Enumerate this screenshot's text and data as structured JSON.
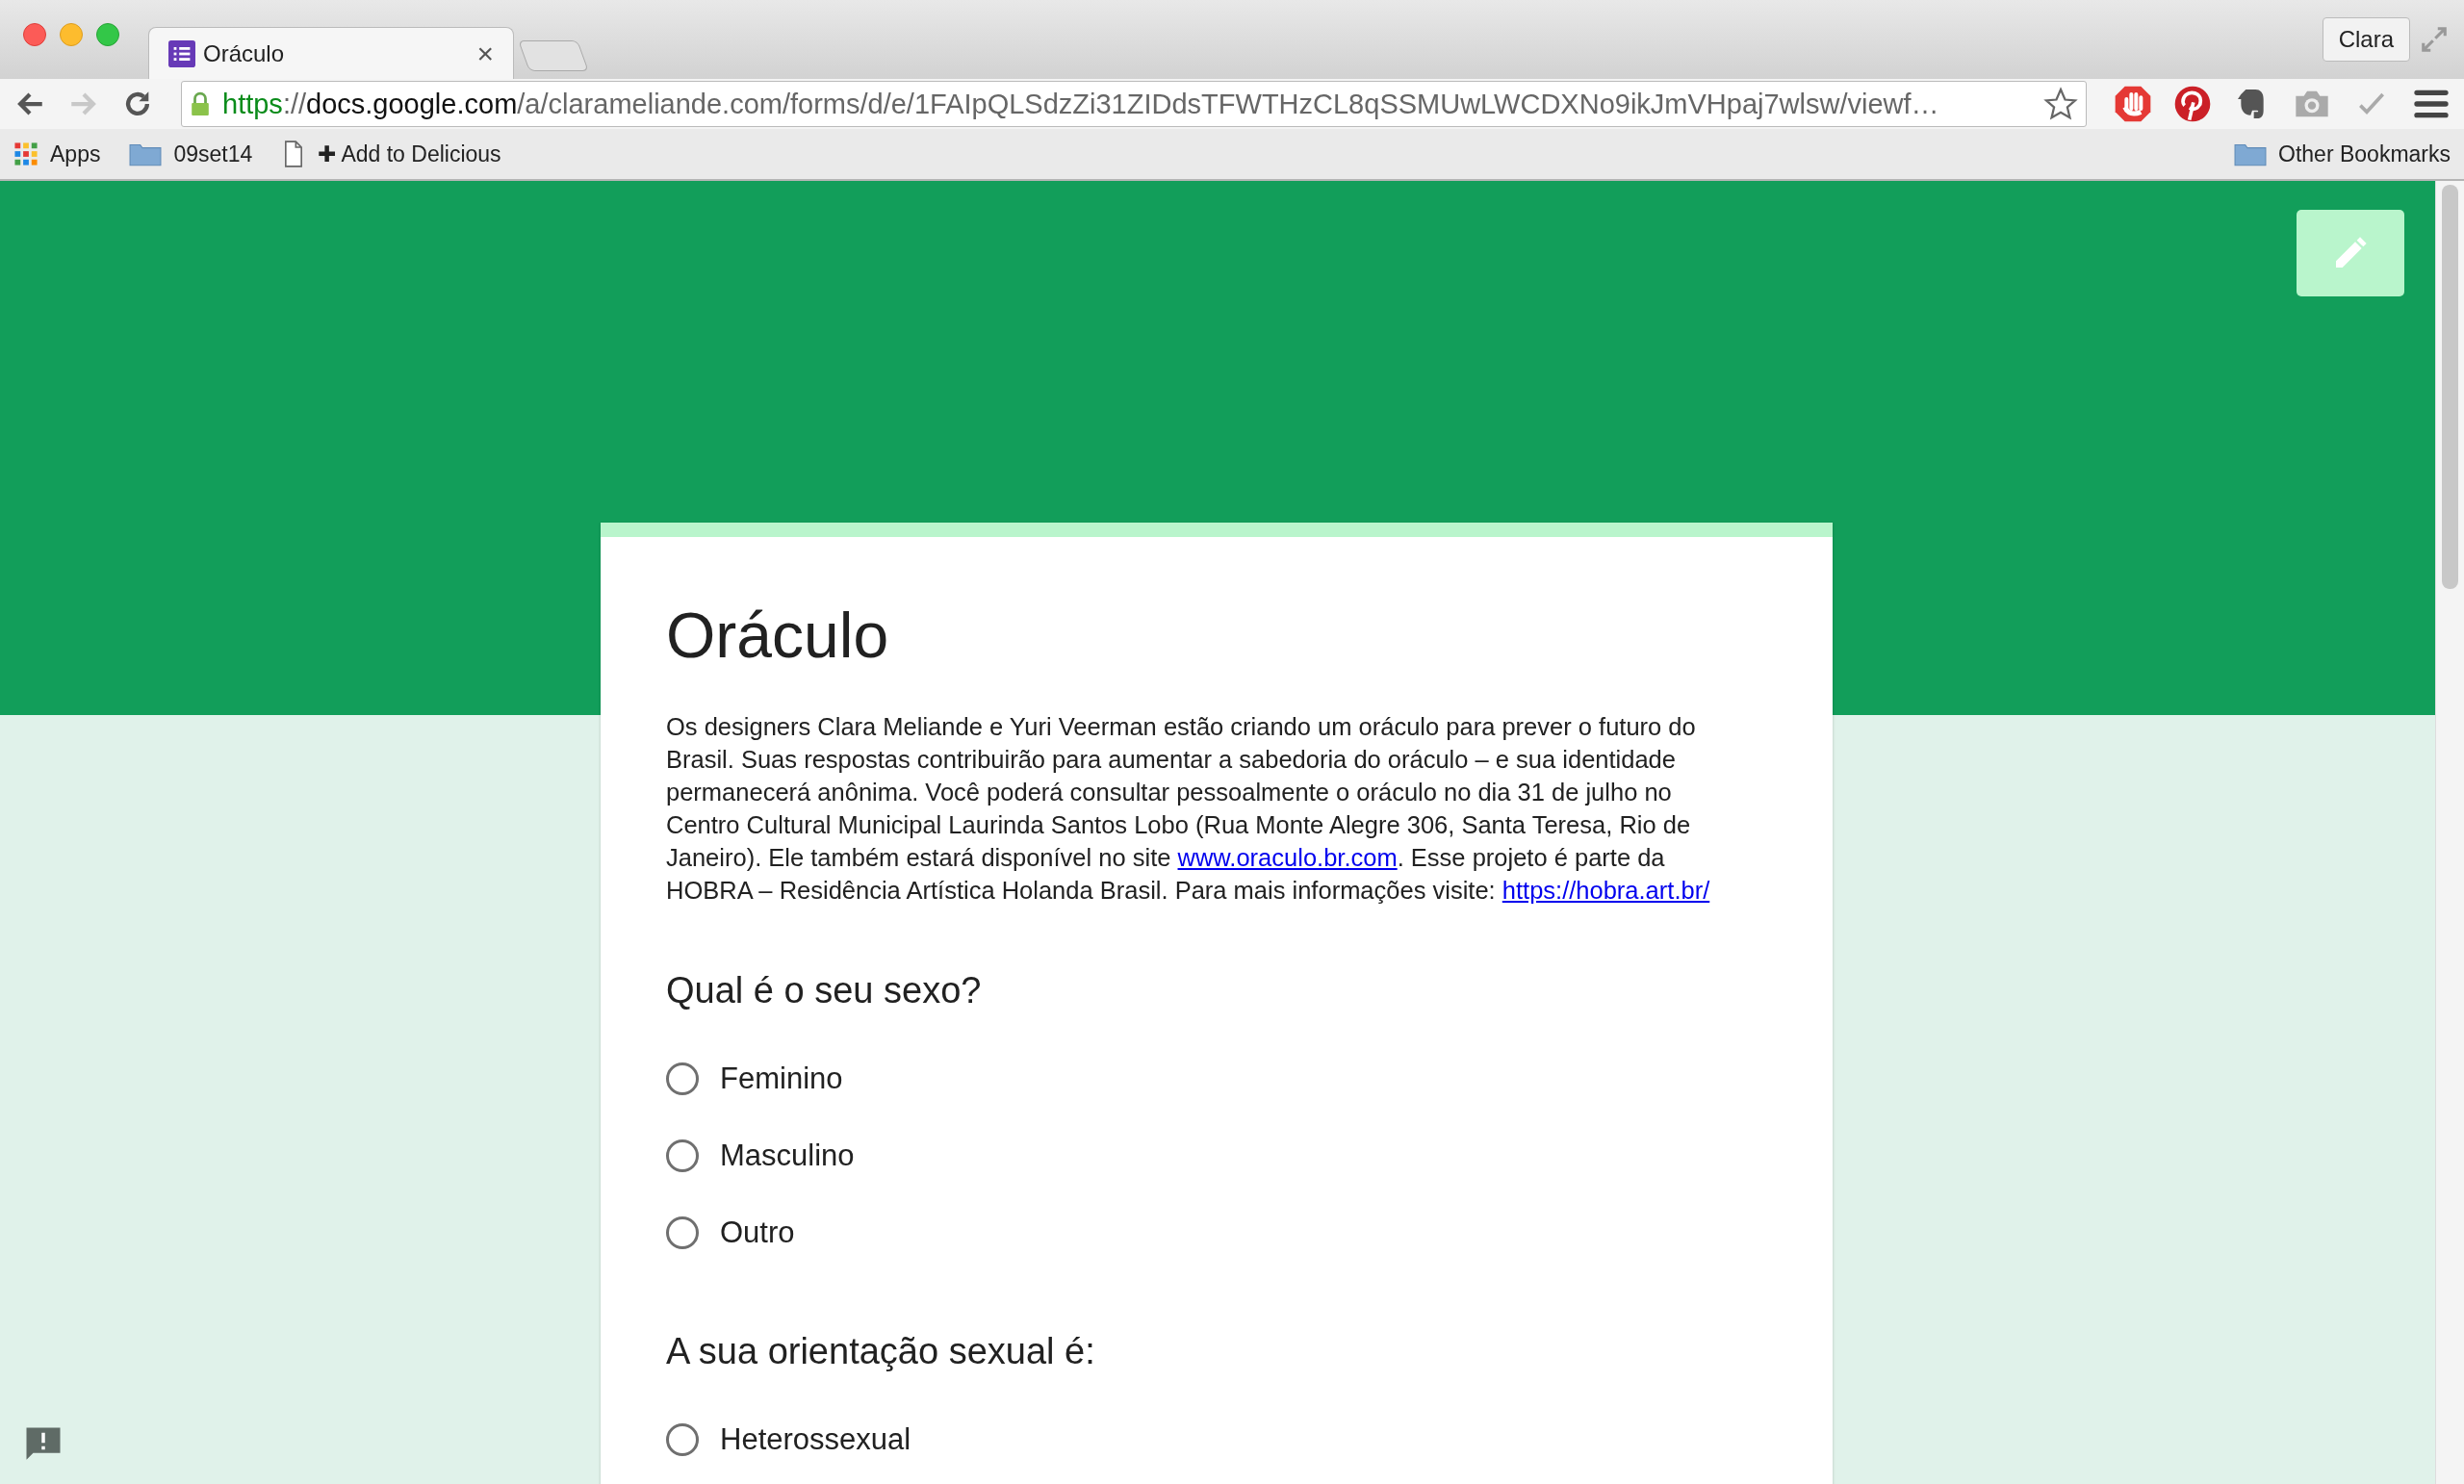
{
  "browser": {
    "tab": {
      "title": "Oráculo",
      "close": "×",
      "selected": true
    },
    "profile": "Clara",
    "url": {
      "scheme": "https",
      "separator": "://",
      "host": "docs.google.com",
      "path": "/a/clarameliande.com/forms/d/e/1FAIpQLSdzZi31ZIDdsTFWTHzCL8qSSMUwLWCDXNo9ikJmVHpaj7wlsw/viewf…"
    },
    "bookmarks": [
      {
        "kind": "apps",
        "label": "Apps"
      },
      {
        "kind": "folder",
        "label": "09set14"
      },
      {
        "kind": "page",
        "label": "✚ Add to Delicious"
      }
    ],
    "other_bookmarks": "Other Bookmarks"
  },
  "form": {
    "title": "Oráculo",
    "description": [
      {
        "kind": "text",
        "text": "Os designers Clara Meliande e Yuri Veerman estão criando um oráculo para prever o futuro do Brasil. Suas respostas contribuirão para aumentar a sabedoria do oráculo – e sua identidade permanecerá anônima. Você poderá consultar pessoalmente o oráculo no dia 31 de julho no Centro Cultural Municipal Laurinda Santos Lobo (Rua Monte Alegre 306, Santa Teresa, Rio de Janeiro). Ele também estará disponível no site "
      },
      {
        "kind": "link",
        "text": "www.oraculo.br.com"
      },
      {
        "kind": "text",
        "text": ". Esse projeto é parte da HOBRA – Residência Artística Holanda Brasil. Para mais informações visite: "
      },
      {
        "kind": "link",
        "text": "https://hobra.art.br/"
      }
    ],
    "questions": [
      {
        "title": "Qual é o seu sexo?",
        "options": [
          {
            "label": "Feminino",
            "selected": false
          },
          {
            "label": "Masculino",
            "selected": false
          },
          {
            "label": "Outro",
            "selected": false
          }
        ]
      },
      {
        "title": "A sua orientação sexual é:",
        "options": [
          {
            "label": "Heterossexual",
            "selected": false
          }
        ]
      }
    ]
  }
}
